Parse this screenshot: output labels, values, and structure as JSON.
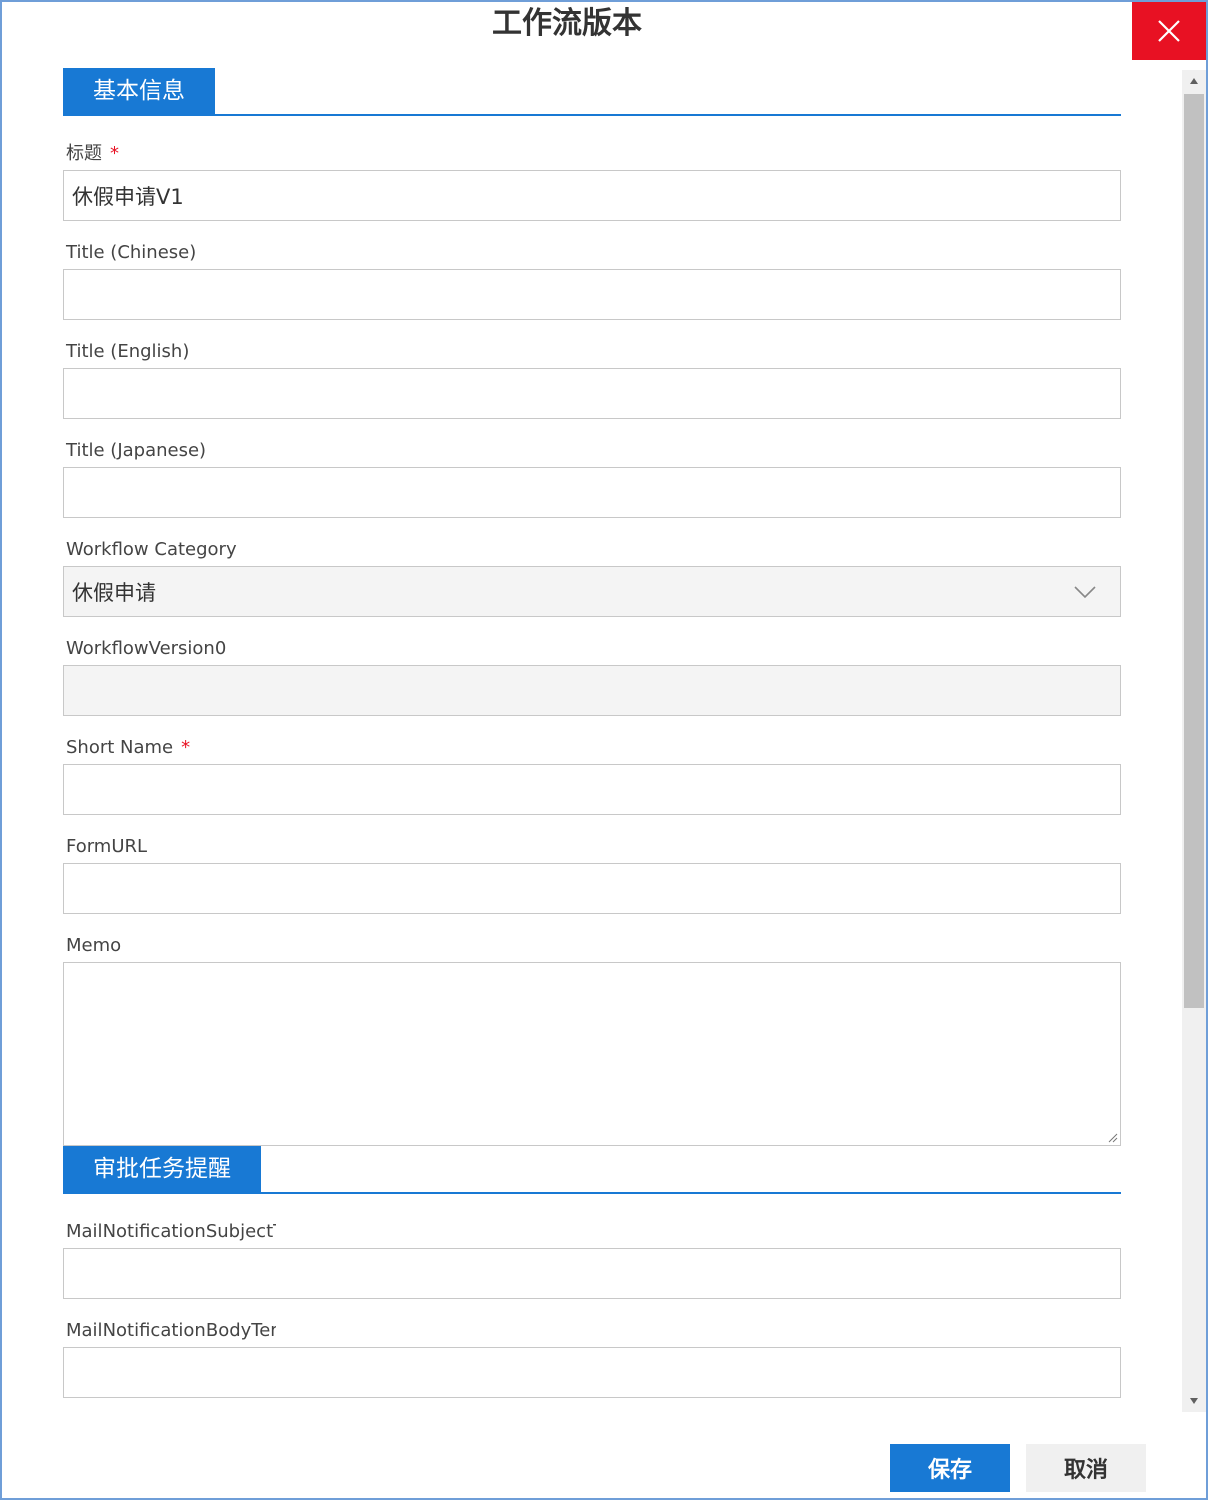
{
  "dialog": {
    "title": "工作流版本",
    "close_icon": "close-icon"
  },
  "section_basic": {
    "tab_label": "基本信息"
  },
  "fields": {
    "title": {
      "label": "标题",
      "required": "*",
      "value": "休假申请V1"
    },
    "title_chinese": {
      "label": "Title (Chinese)",
      "value": ""
    },
    "title_english": {
      "label": "Title (English)",
      "value": ""
    },
    "title_japanese": {
      "label": "Title (Japanese)",
      "value": ""
    },
    "workflow_category": {
      "label": "Workflow Category",
      "value": "休假申请",
      "icon": "chevron-down-icon"
    },
    "workflow_version": {
      "label": "WorkflowVersion0",
      "value": ""
    },
    "short_name": {
      "label": "Short Name",
      "required": "*",
      "value": ""
    },
    "form_url": {
      "label": "FormURL",
      "value": ""
    },
    "memo": {
      "label": "Memo",
      "value": ""
    }
  },
  "section_reminder": {
    "tab_label": "审批任务提醒"
  },
  "reminder_fields": {
    "mail_subject": {
      "label": "MailNotificationSubjectTe",
      "value": ""
    },
    "mail_body": {
      "label": "MailNotificationBodyTem",
      "value": ""
    }
  },
  "buttons": {
    "save_label": "保存",
    "cancel_label": "取消"
  },
  "colors": {
    "accent": "#1879d4",
    "close": "#e81123",
    "required": "#e81123",
    "border": "#6f9ed8"
  }
}
